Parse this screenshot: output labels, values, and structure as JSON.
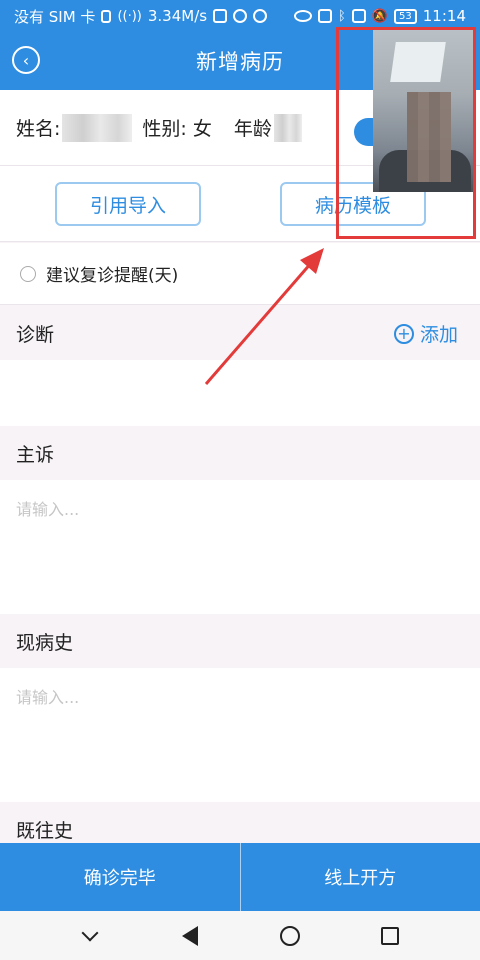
{
  "status_bar": {
    "left_text": "没有 SIM 卡",
    "speed": "3.34M/s",
    "battery": "53",
    "time": "11:14"
  },
  "header": {
    "title": "新增病历"
  },
  "patient": {
    "name_label": "姓名:",
    "gender_label": "性别:",
    "gender_value": "女",
    "age_label": "年龄"
  },
  "actions": {
    "import_label": "引用导入",
    "template_label": "病历模板"
  },
  "recheck": {
    "label": "建议复诊提醒(天)"
  },
  "sections": {
    "diagnosis": {
      "title": "诊断",
      "add_label": "添加"
    },
    "chief_complaint": {
      "title": "主诉",
      "placeholder": "请输入..."
    },
    "present_illness": {
      "title": "现病史",
      "placeholder": "请输入..."
    },
    "past_history": {
      "title": "既往史"
    }
  },
  "bottom_bar": {
    "confirm_label": "确诊完毕",
    "prescribe_label": "线上开方"
  },
  "colors": {
    "primary": "#2e8de0",
    "annotation_red": "#e33a3a"
  }
}
